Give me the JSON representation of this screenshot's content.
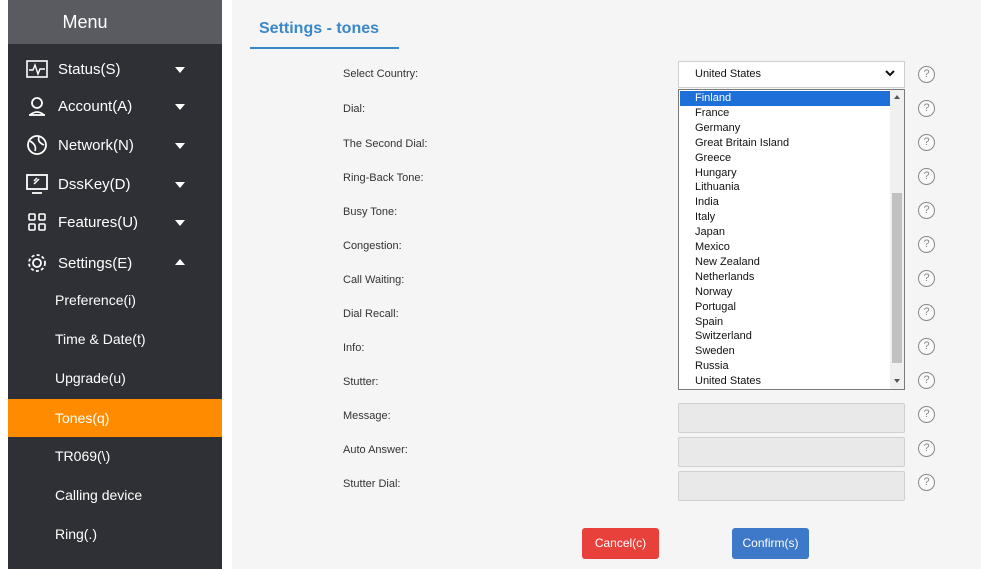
{
  "sidebar": {
    "header": "Menu",
    "items": [
      {
        "label": "Status(S)",
        "icon": "status-icon"
      },
      {
        "label": "Account(A)",
        "icon": "account-icon"
      },
      {
        "label": "Network(N)",
        "icon": "network-icon"
      },
      {
        "label": "DssKey(D)",
        "icon": "dsskey-icon"
      },
      {
        "label": "Features(U)",
        "icon": "features-icon"
      },
      {
        "label": "Settings(E)",
        "icon": "settings-gear-icon"
      }
    ],
    "settings_sub": [
      {
        "label": "Preference(i)"
      },
      {
        "label": "Time & Date(t)"
      },
      {
        "label": "Upgrade(u)"
      },
      {
        "label": "Tones(q)",
        "active": true
      },
      {
        "label": "TR069(\\)"
      },
      {
        "label": "Calling device"
      },
      {
        "label": "Ring(.)"
      }
    ]
  },
  "main": {
    "title": "Settings - tones",
    "select_country": {
      "label": "Select Country:",
      "value": "United States",
      "options": [
        "Finland",
        "France",
        "Germany",
        "Great Britain Island",
        "Greece",
        "Hungary",
        "Lithuania",
        "India",
        "Italy",
        "Japan",
        "Mexico",
        "New Zealand",
        "Netherlands",
        "Norway",
        "Portugal",
        "Spain",
        "Switzerland",
        "Sweden",
        "Russia",
        "United States"
      ],
      "highlighted": "Finland"
    },
    "rows": [
      {
        "label": "Dial:"
      },
      {
        "label": "The Second Dial:"
      },
      {
        "label": "Ring-Back Tone:"
      },
      {
        "label": "Busy Tone:"
      },
      {
        "label": "Congestion:"
      },
      {
        "label": "Call Waiting:"
      },
      {
        "label": "Dial Recall:"
      },
      {
        "label": "Info:"
      },
      {
        "label": "Stutter:"
      },
      {
        "label": "Message:"
      },
      {
        "label": "Auto Answer:"
      },
      {
        "label": "Stutter Dial:"
      }
    ],
    "help_glyph": "?",
    "buttons": {
      "cancel": "Cancel(c)",
      "confirm": "Confirm(s)"
    },
    "colors": {
      "accent": "#3a87c9",
      "active_nav": "#ff8c00",
      "cancel": "#e8413b",
      "confirm": "#3e78c8",
      "sidebar_bg": "#2f3035"
    }
  }
}
